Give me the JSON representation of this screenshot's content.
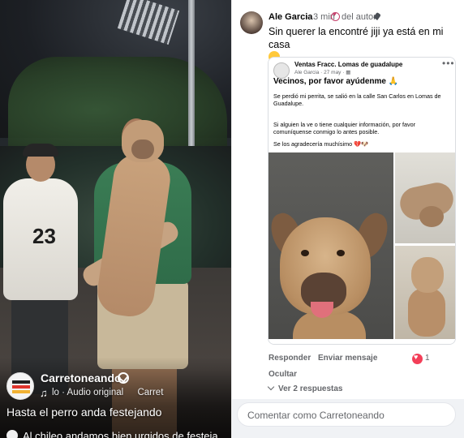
{
  "video_post": {
    "page_name": "Carretoneando",
    "audio": "lo · Audio original",
    "audio_trail": "Carret",
    "caption": "Hasta el perro anda festejando",
    "comment_peek": "Al chileo andamos bien urgidos de festeja"
  },
  "comment": {
    "author": "Ale Garcia",
    "time": "3 min",
    "badge": "del autor",
    "text": "Sin querer la encontré jiji ya está en mi casa"
  },
  "shared_post": {
    "page": "Ventas Fracc. Lomas de guadalupe",
    "meta": "Ale Garcia · 27 may · ▦",
    "more": "•••",
    "title": "Vecinos, por favor ayúdenme 🙏",
    "p1": "Se perdió mi perrita, se salió en la calle San Carlos en Lomas de Guadalupe.",
    "p2": "Si alguien la ve o tiene cualquier información, por favor comuníquense conmigo lo antes posible.",
    "p3": "Se los agradecería muchísimo 💔🐶"
  },
  "actions": {
    "reply": "Responder",
    "send": "Enviar mensaje",
    "reactions": "1",
    "hide": "Ocultar",
    "replies": "Ver 2 respuestas"
  },
  "composer": {
    "placeholder": "Comentar como Carretoneando"
  },
  "colors": {
    "reaction_heart": "#f33e58",
    "author_badge": "#c53f6a"
  }
}
